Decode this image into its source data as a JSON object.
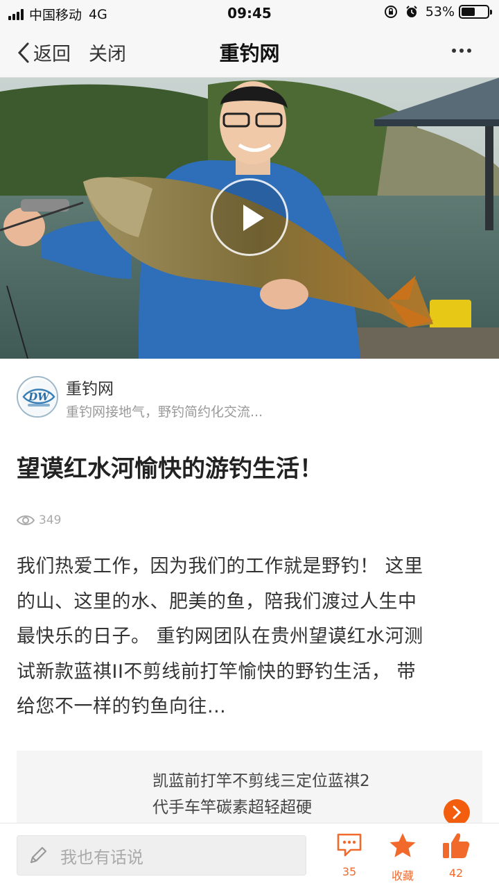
{
  "status_bar": {
    "carrier": "中国移动",
    "network": "4G",
    "time": "09:45",
    "battery_percent": "53%",
    "battery_level": 0.53,
    "icons": [
      "signal-icon",
      "orientation-lock-icon",
      "alarm-icon",
      "battery-icon"
    ]
  },
  "nav": {
    "back_label": "返回",
    "close_label": "关闭",
    "title": "重钓网",
    "more_icon": "more-icon"
  },
  "video": {
    "play_icon": "play-icon"
  },
  "author": {
    "name": "重钓网",
    "description": "重钓网接地气，野钓简约化交流..."
  },
  "article": {
    "title": "望谟红水河愉快的游钓生活！",
    "views": "349",
    "body_lines": [
      "我们热爱工作，因为我们的工作就是野钓！ 这里",
      "的山、这里的水、肥美的鱼，陪我们渡过人生中",
      "最快乐的日子。 重钓网团队在贵州望谟红水河测",
      "试新款蓝祺II不剪线前打竿愉快的野钓生活， 带",
      "给您不一样的钓鱼向往..."
    ]
  },
  "product": {
    "title_line1": "凯蓝前打竿不剪线三定位蓝祺2",
    "title_line2": "代手车竿碳素超轻超硬"
  },
  "bottom_bar": {
    "placeholder": "我也有话说",
    "comment_count": "35",
    "favorite_label": "收藏",
    "like_count": "42"
  },
  "colors": {
    "accent": "#f26a2b",
    "arrow": "#f25d0e"
  }
}
